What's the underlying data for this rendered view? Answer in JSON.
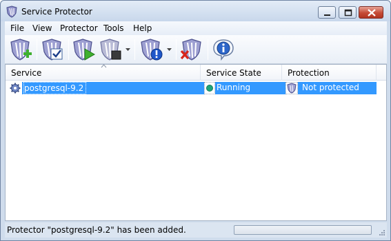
{
  "window": {
    "title": "Service Protector"
  },
  "menu": [
    "File",
    "View",
    "Protector",
    "Tools",
    "Help"
  ],
  "toolbar": {
    "buttons": [
      "add-protector-icon",
      "edit-protector-icon",
      "start-service-icon",
      "stop-service-icon",
      "alerts-icon",
      "remove-protector-icon",
      "about-info-icon"
    ]
  },
  "list": {
    "columns": [
      "Service",
      "Service State",
      "Protection"
    ],
    "rows": [
      {
        "service": "postgresql-9.2",
        "state": "Running",
        "protection": "Not protected"
      }
    ]
  },
  "status": {
    "message": "Protector \"postgresql-9.2\" has been added.",
    "progress": 0
  },
  "colors": {
    "selection": "#3399ff",
    "running_dot": "#1fa67a",
    "close_button": "#c54a35"
  }
}
